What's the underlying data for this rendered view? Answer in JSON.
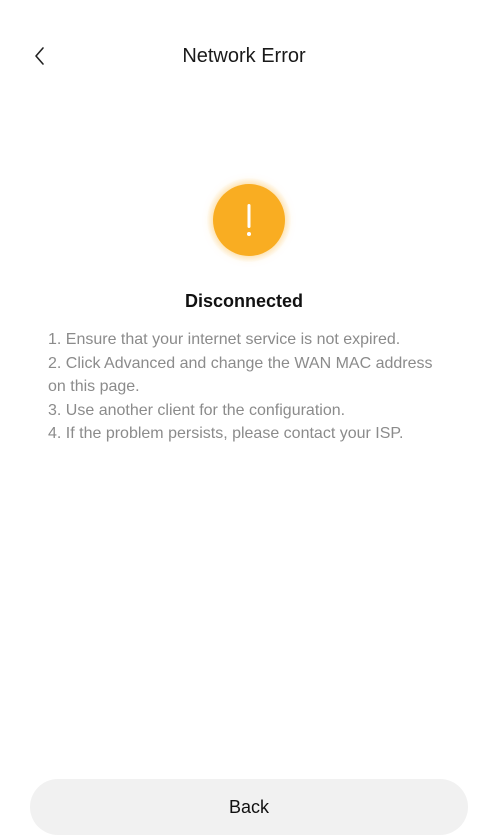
{
  "header": {
    "title": "Network Error",
    "back_icon": "chevron-left-icon"
  },
  "status": {
    "icon": "warning-icon",
    "icon_color": "#f9ad22",
    "title": "Disconnected"
  },
  "tips": [
    "1. Ensure that your internet service is not expired.",
    "2. Click Advanced and change the WAN MAC address on this page.",
    "3. Use another client for the configuration.",
    "4. If the problem persists, please contact your ISP."
  ],
  "footer": {
    "back_label": "Back"
  },
  "colors": {
    "background": "#ffffff",
    "tip_text": "#8b8b8b",
    "button_bg": "#f1f1f1"
  }
}
